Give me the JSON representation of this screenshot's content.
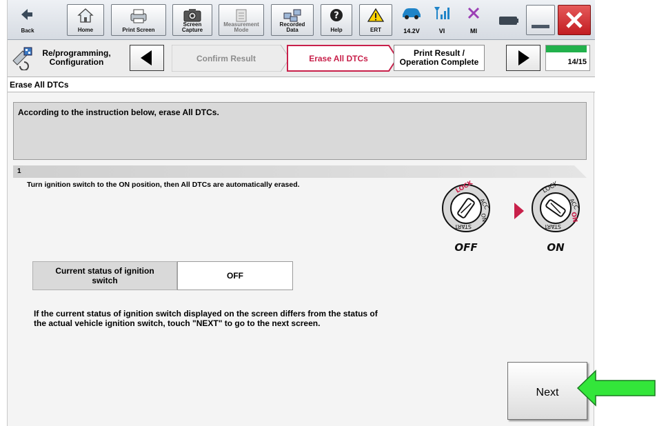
{
  "toolbar": {
    "back_label": "Back",
    "home_label": "Home",
    "print_screen_label": "Print Screen",
    "screen_capture_line1": "Screen",
    "screen_capture_line2": "Capture",
    "measurement_line1": "Measurement",
    "measurement_line2": "Mode",
    "recorded_line1": "Recorded",
    "recorded_line2": "Data",
    "help_label": "Help",
    "ert_label": "ERT",
    "voltage": "14.2V",
    "vi_label": "VI",
    "mi_label": "MI"
  },
  "breadcrumb": {
    "app_line1": "Re/programming,",
    "app_line2": "Configuration",
    "step_prev": "Confirm Result",
    "step_current": "Erase All DTCs",
    "step_next_line1": "Print Result /",
    "step_next_line2": "Operation Complete",
    "progress": "14/15",
    "progress_fraction": 0.93
  },
  "page": {
    "title": "Erase All DTCs",
    "instruction": "According to the instruction below, erase All DTCs.",
    "step_number": "1",
    "step_text": "Turn ignition switch to the ON position, then All DTCs are automatically erased.",
    "off_label": "OFF",
    "on_label": "ON",
    "key_lock": "LOCK",
    "key_acc": "ACC",
    "key_on": "ON",
    "key_start": "START",
    "status_label_line1": "Current status of ignition",
    "status_label_line2": "switch",
    "status_value": "OFF",
    "note_line1": "If the current status of ignition switch displayed on the screen differs from the status of",
    "note_line2": "the actual vehicle ignition switch, touch \"NEXT\" to go to the next screen.",
    "next_label": "Next"
  },
  "colors": {
    "accent": "#c8204a",
    "progress_green": "#22b14c",
    "arrow_green": "#33e63a",
    "close_red": "#d9262b"
  }
}
